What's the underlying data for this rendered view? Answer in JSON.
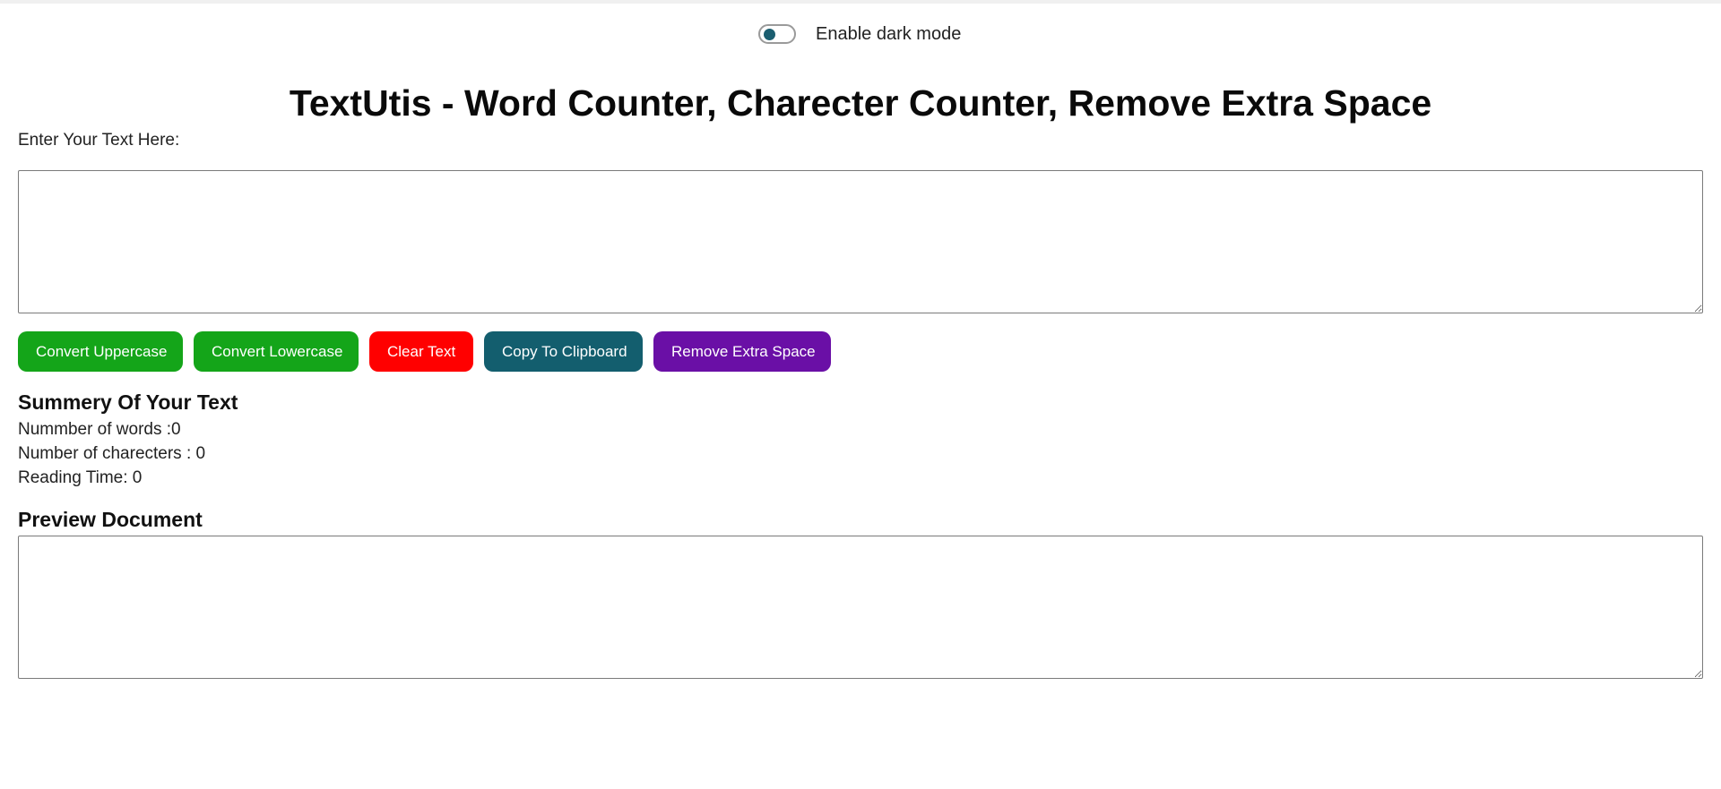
{
  "dark_mode": {
    "label": "Enable dark mode",
    "enabled": false,
    "knob_color": "#1b5e70"
  },
  "title": "TextUtis - Word Counter, Charecter Counter, Remove Extra Space",
  "input": {
    "label": "Enter Your Text Here:",
    "value": ""
  },
  "buttons": {
    "uppercase": {
      "label": "Convert Uppercase",
      "color": "#14a519"
    },
    "lowercase": {
      "label": "Convert Lowercase",
      "color": "#14a519"
    },
    "clear": {
      "label": "Clear Text",
      "color": "#ff0000"
    },
    "copy": {
      "label": "Copy To Clipboard",
      "color": "#135e6e"
    },
    "remove_space": {
      "label": "Remove Extra Space",
      "color": "#6a0fa6"
    }
  },
  "summary": {
    "heading": "Summery Of Your Text",
    "words": "Nummber of words :0",
    "characters": "Number of charecters : 0",
    "reading_time": "Reading Time: 0"
  },
  "preview": {
    "heading": "Preview Document",
    "value": ""
  }
}
